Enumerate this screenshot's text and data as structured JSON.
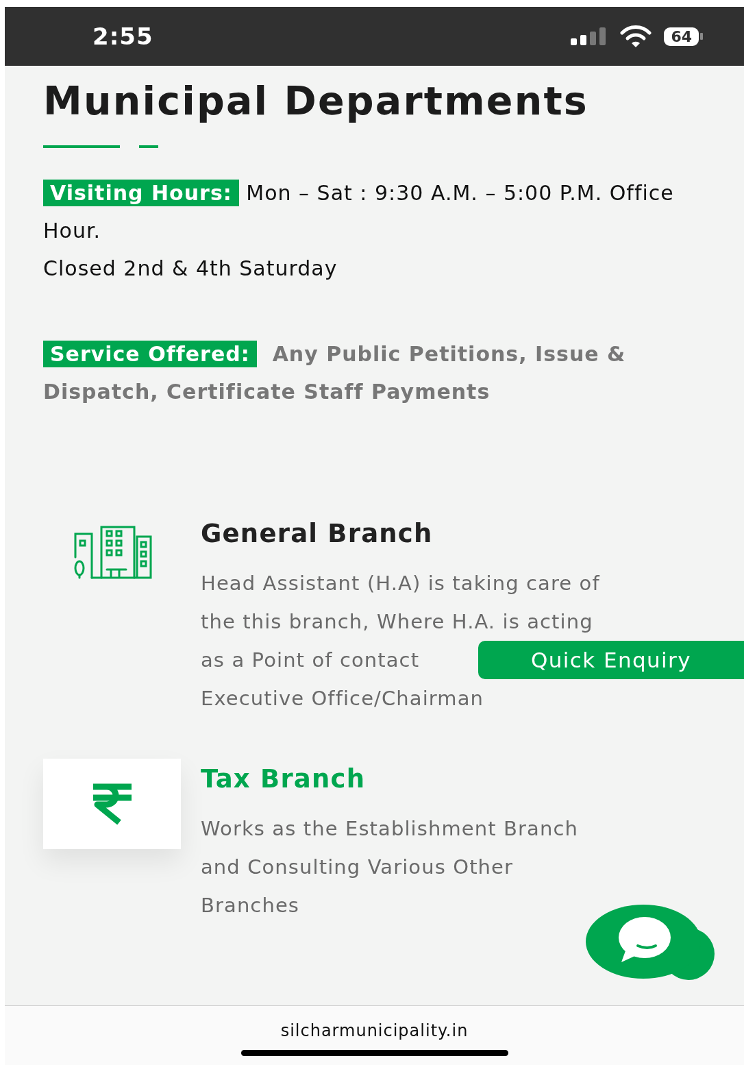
{
  "status_bar": {
    "time": "2:55",
    "battery": "64"
  },
  "page": {
    "title": "Municipal Departments",
    "visiting": {
      "label": "Visiting Hours:",
      "text": "Mon – Sat : 9:30 A.M. – 5:00 P.M. Office Hour.",
      "note": "Closed 2nd & 4th Saturday"
    },
    "service": {
      "label": "Service Offered:",
      "text": "Any Public Petitions, Issue & Dispatch, Certificate Staff Payments"
    },
    "branches": [
      {
        "name": "General Branch",
        "kind": "buildings",
        "active": false,
        "lines": [
          "Head Assistant (H.A) is taking care of",
          "the this branch, Where H.A. is acting",
          "as a Point of contact",
          "Executive Office/Chairman"
        ]
      },
      {
        "name": "Tax Branch",
        "kind": "rupee",
        "active": true,
        "lines": [
          "Works as the Establishment Branch",
          "and Consulting Various Other",
          "Branches"
        ]
      }
    ]
  },
  "quick_enquiry": "Quick Enquiry",
  "footer": {
    "url": "silcharmunicipality.in"
  }
}
